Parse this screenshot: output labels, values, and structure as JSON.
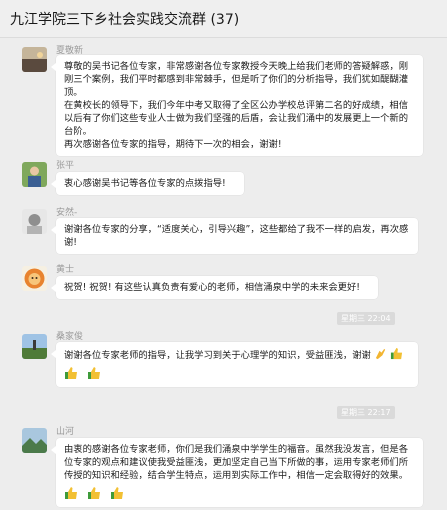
{
  "chat": {
    "title": "九江学院三下乡社会实践交流群 (37)"
  },
  "messages": [
    {
      "sender": "夏敬新",
      "paragraphs": [
        "尊敬的吴书记各位专家，非常感谢各位专家教授今天晚上给我们老师的答疑解惑，刚刚三个案例，我们平时都感到非常棘手，但是听了你们的分析指导，我们犹如醍醐灌顶。",
        "在黄校长的领导下，我们今年中考又取得了全区公办学校总评第二名的好成绩，相信以后有了你们这些专业人士做为我们坚强的后盾，会让我们涌中的发展更上一个新的台阶。",
        "再次感谢各位专家的指导，期待下一次的相会，谢谢!"
      ]
    },
    {
      "sender": "张平",
      "text": "衷心感谢吴书记等各位专家的点拨指导!"
    },
    {
      "sender": "安然-",
      "text": "谢谢各位专家的分享，“适度关心，引导兴趣”，这些都给了我不一样的启发，再次感谢!"
    },
    {
      "sender": "黄士",
      "text": "祝贺! 祝贺! 有这些认真负责有爱心的老师，相信涌泉中学的未来会更好!"
    },
    {
      "timestamp": "星期三 22:04"
    },
    {
      "sender": "桑家俊",
      "text": "谢谢各位专家老师的指导，让我学习到关于心理学的知识，受益匪浅，谢谢",
      "emoji_inline": [
        "hands-together-icon",
        "thumbs-up-icon"
      ],
      "emoji_row": [
        "thumbs-up-icon",
        "thumbs-up-icon"
      ]
    },
    {
      "timestamp": "星期三 22:17"
    },
    {
      "sender": "山河",
      "text": "由衷的感谢各位专家老师，你们是我们涌泉中学学生的福音。虽然我没发言，但是各位专家的观点和建议使我受益匪浅，更加坚定自己当下所做的事，运用专家老师们所传授的知识和经验，结合学生特点，运用到实际工作中，相信一定会取得好的效果。",
      "emoji_row": [
        "thumbs-up-icon",
        "thumbs-up-icon",
        "thumbs-up-icon"
      ]
    }
  ]
}
